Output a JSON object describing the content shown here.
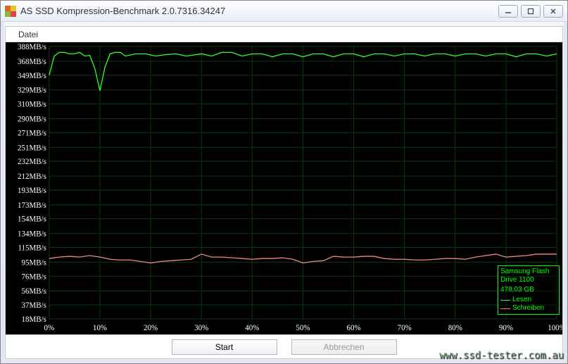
{
  "window": {
    "title": "AS SSD Kompression-Benchmark 2.0.7316.34247"
  },
  "menubar": {
    "file_label": "Datei"
  },
  "buttons": {
    "start_label": "Start",
    "abort_label": "Abbrechen"
  },
  "legend": {
    "device": "Samsung Flash Drive",
    "device_line2": "1100",
    "size": "478,03 GB",
    "read_label": "Lesen",
    "write_label": "Schreiben"
  },
  "watermark": "www.ssd-tester.com.au",
  "chart_data": {
    "type": "line",
    "xlabel": "",
    "ylabel": "",
    "x_unit": "%",
    "y_unit": "MB/s",
    "xlim": [
      0,
      100
    ],
    "ylim": [
      18,
      388
    ],
    "x_ticks": [
      0,
      10,
      20,
      30,
      40,
      50,
      60,
      70,
      80,
      90,
      100
    ],
    "y_ticks": [
      18,
      37,
      56,
      76,
      95,
      115,
      134,
      154,
      173,
      193,
      212,
      232,
      251,
      271,
      290,
      310,
      329,
      349,
      368,
      388
    ],
    "series": [
      {
        "name": "Lesen",
        "color": "#33ff33",
        "x": [
          0,
          1,
          2,
          3,
          4,
          5,
          6,
          7,
          8,
          9,
          10,
          11,
          12,
          13,
          14,
          15,
          17,
          19,
          21,
          23,
          25,
          27,
          30,
          32,
          34,
          36,
          38,
          40,
          42,
          44,
          46,
          48,
          50,
          52,
          54,
          56,
          58,
          60,
          62,
          64,
          66,
          68,
          70,
          72,
          74,
          76,
          78,
          80,
          82,
          84,
          86,
          88,
          90,
          92,
          94,
          96,
          98,
          100
        ],
        "values": [
          349,
          375,
          380,
          380,
          378,
          378,
          380,
          375,
          376,
          358,
          328,
          360,
          378,
          380,
          380,
          375,
          378,
          378,
          375,
          377,
          378,
          375,
          378,
          375,
          380,
          380,
          375,
          378,
          378,
          374,
          378,
          378,
          374,
          378,
          378,
          374,
          378,
          378,
          374,
          378,
          378,
          375,
          378,
          378,
          375,
          378,
          378,
          375,
          378,
          378,
          375,
          378,
          378,
          374,
          378,
          378,
          375,
          378
        ]
      },
      {
        "name": "Schreiben",
        "color": "#ee8888",
        "x": [
          0,
          2,
          4,
          6,
          8,
          10,
          12,
          14,
          16,
          18,
          20,
          22,
          24,
          26,
          28,
          30,
          32,
          34,
          36,
          38,
          40,
          42,
          44,
          46,
          48,
          50,
          52,
          54,
          56,
          58,
          60,
          62,
          64,
          66,
          68,
          70,
          72,
          74,
          76,
          78,
          80,
          82,
          84,
          86,
          88,
          90,
          92,
          94,
          96,
          98,
          100
        ],
        "values": [
          100,
          102,
          103,
          102,
          104,
          102,
          99,
          98,
          98,
          96,
          94,
          96,
          97,
          98,
          99,
          106,
          102,
          102,
          101,
          100,
          99,
          100,
          100,
          101,
          99,
          94,
          96,
          97,
          103,
          102,
          102,
          103,
          103,
          100,
          99,
          99,
          98,
          98,
          99,
          100,
          100,
          99,
          102,
          104,
          106,
          102,
          103,
          104,
          106,
          106,
          106
        ]
      }
    ]
  }
}
